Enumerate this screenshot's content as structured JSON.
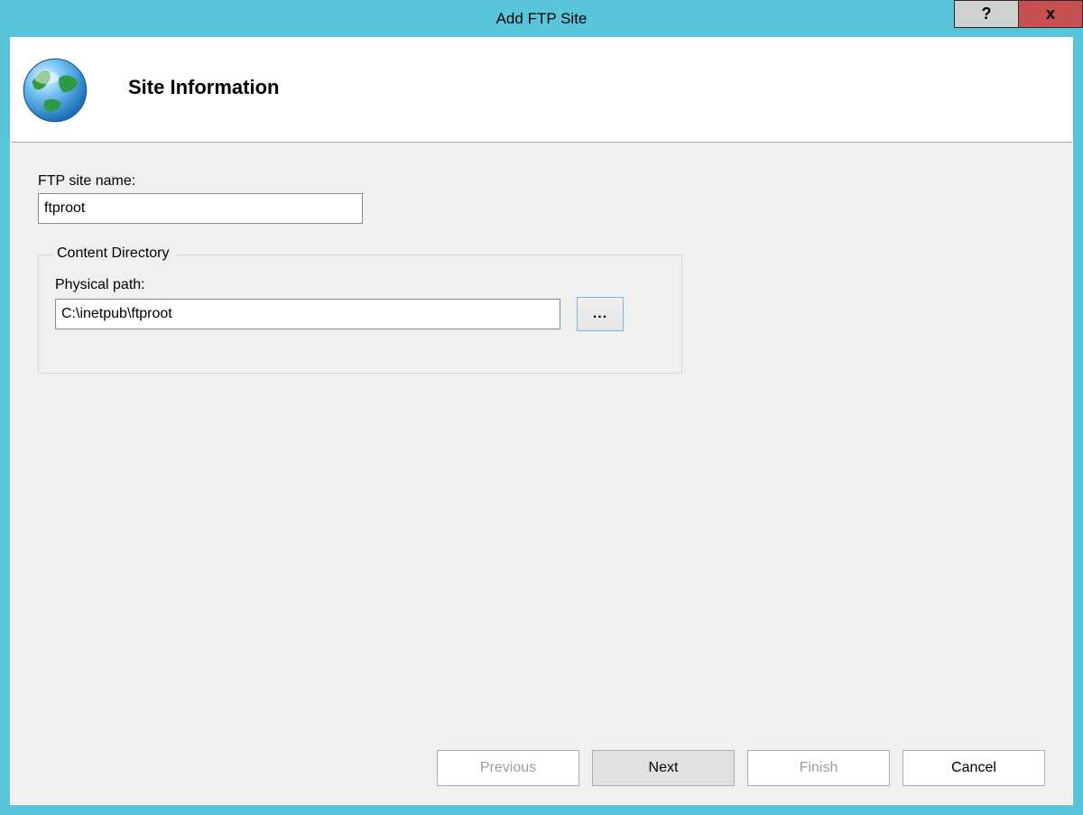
{
  "window": {
    "title": "Add FTP Site",
    "help_label": "?",
    "close_label": "x"
  },
  "header": {
    "heading": "Site Information",
    "icon_name": "globe-icon"
  },
  "form": {
    "site_name_label": "FTP site name:",
    "site_name_value": "ftproot",
    "content_directory_legend": "Content Directory",
    "physical_path_label": "Physical path:",
    "physical_path_value": "C:\\inetpub\\ftproot",
    "browse_label": "..."
  },
  "wizard_buttons": {
    "previous": "Previous",
    "next": "Next",
    "finish": "Finish",
    "cancel": "Cancel",
    "previous_enabled": false,
    "next_enabled": true,
    "finish_enabled": false,
    "cancel_enabled": true
  }
}
